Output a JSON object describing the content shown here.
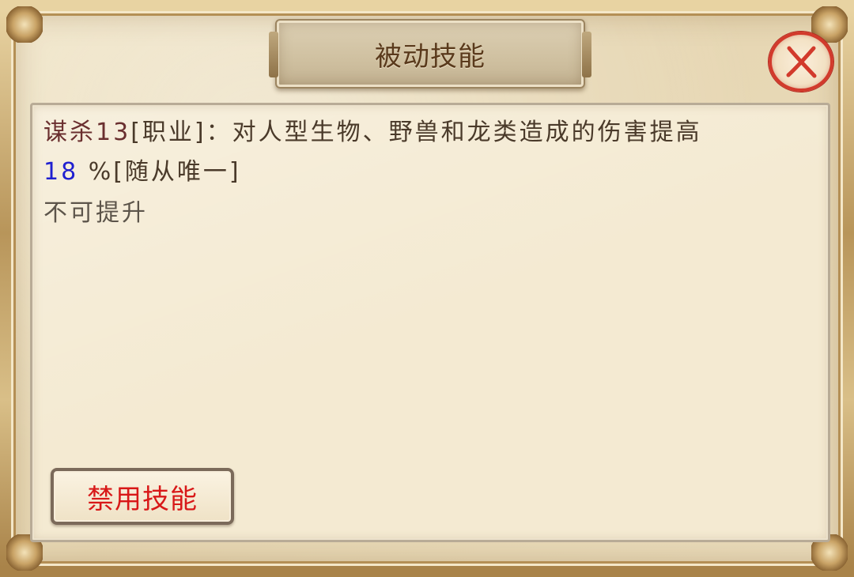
{
  "dialog": {
    "title": "被动技能",
    "close_icon": "close-x-icon"
  },
  "skill": {
    "name": "谋杀13",
    "line1_rest": "[职业]：对人型生物、野兽和龙类造成的伤害提高",
    "value": "18",
    "line2_rest": " %[随从唯一]",
    "upgrade_status": "不可提升"
  },
  "actions": {
    "disable_label": "禁用技能"
  },
  "colors": {
    "skill_name": "#6a2f2f",
    "value_highlight": "#2020d0",
    "disable_text": "#d81818",
    "close_red": "#d23a2c"
  }
}
